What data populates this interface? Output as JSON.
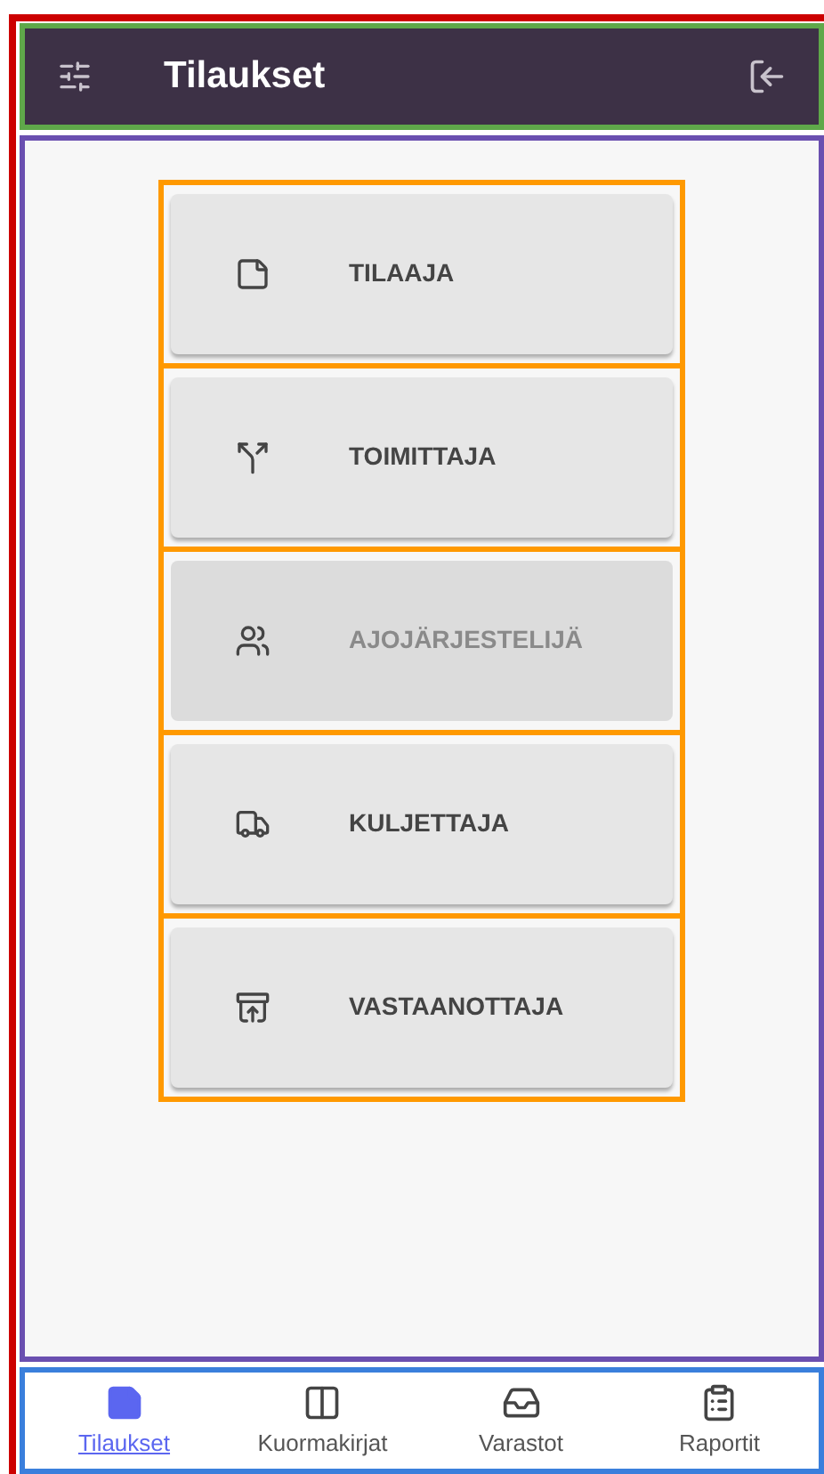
{
  "header": {
    "title": "Tilaukset"
  },
  "roles": [
    {
      "label": "TILAAJA",
      "disabled": false
    },
    {
      "label": "TOIMITTAJA",
      "disabled": false
    },
    {
      "label": "AJOJÄRJESTELIJÄ",
      "disabled": true
    },
    {
      "label": "KULJETTAJA",
      "disabled": false
    },
    {
      "label": "VASTAANOTTAJA",
      "disabled": false
    }
  ],
  "nav": [
    {
      "label": "Tilaukset",
      "selected": true
    },
    {
      "label": "Kuormakirjat",
      "selected": false
    },
    {
      "label": "Varastot",
      "selected": false
    },
    {
      "label": "Raportit",
      "selected": false
    }
  ]
}
